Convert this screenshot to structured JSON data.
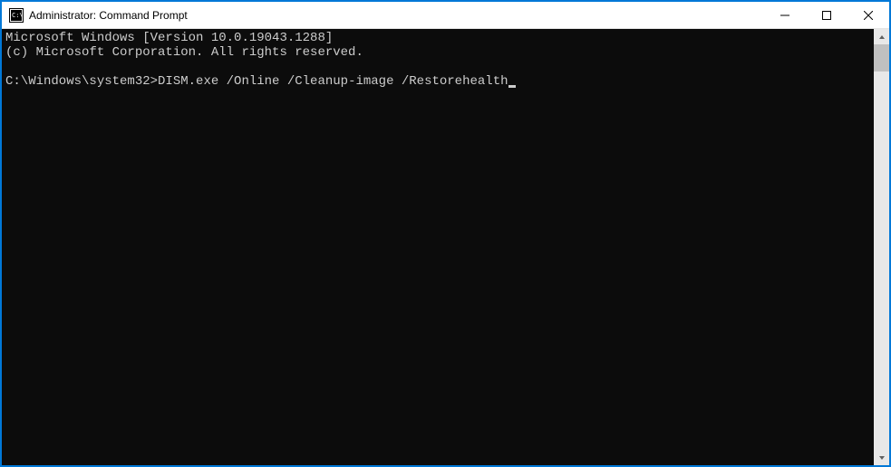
{
  "window": {
    "title": "Administrator: Command Prompt"
  },
  "console": {
    "line1": "Microsoft Windows [Version 10.0.19043.1288]",
    "line2": "(c) Microsoft Corporation. All rights reserved.",
    "blank": "",
    "prompt": "C:\\Windows\\system32>",
    "command": "DISM.exe /Online /Cleanup-image /Restorehealth"
  }
}
